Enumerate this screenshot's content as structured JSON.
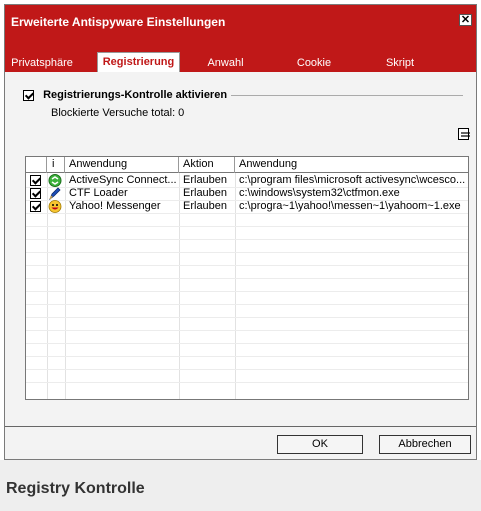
{
  "window": {
    "title": "Erweiterte Antispyware Einstellungen",
    "close_label": "✕",
    "accent_color": "#c01818"
  },
  "tabs": [
    {
      "label": "Privatsphäre",
      "active": false
    },
    {
      "label": "Registrierung",
      "active": true
    },
    {
      "label": "Anwahl",
      "active": false
    },
    {
      "label": "Cookie",
      "active": false
    },
    {
      "label": "Skript",
      "active": false
    }
  ],
  "registry": {
    "enable_label": "Registrierungs-Kontrolle aktivieren",
    "enable_checked": true,
    "blocked_text": "Blockierte Versuche total: 0"
  },
  "table": {
    "columns": [
      "",
      "i",
      "Anwendung",
      "Aktion",
      "Anwendung"
    ],
    "rows": [
      {
        "checked": true,
        "icon": "activesync-icon",
        "name": "ActiveSync Connect...",
        "action": "Erlauben",
        "path": "c:\\program files\\microsoft activesync\\wcesco..."
      },
      {
        "checked": true,
        "icon": "ctf-loader-icon",
        "name": "CTF Loader",
        "action": "Erlauben",
        "path": "c:\\windows\\system32\\ctfmon.exe"
      },
      {
        "checked": true,
        "icon": "yahoo-messenger-icon",
        "name": "Yahoo! Messenger",
        "action": "Erlauben",
        "path": "c:\\progra~1\\yahoo!\\messen~1\\yahoom~1.exe"
      }
    ]
  },
  "buttons": {
    "ok": "OK",
    "cancel": "Abbrechen"
  },
  "caption": "Registry Kontrolle"
}
